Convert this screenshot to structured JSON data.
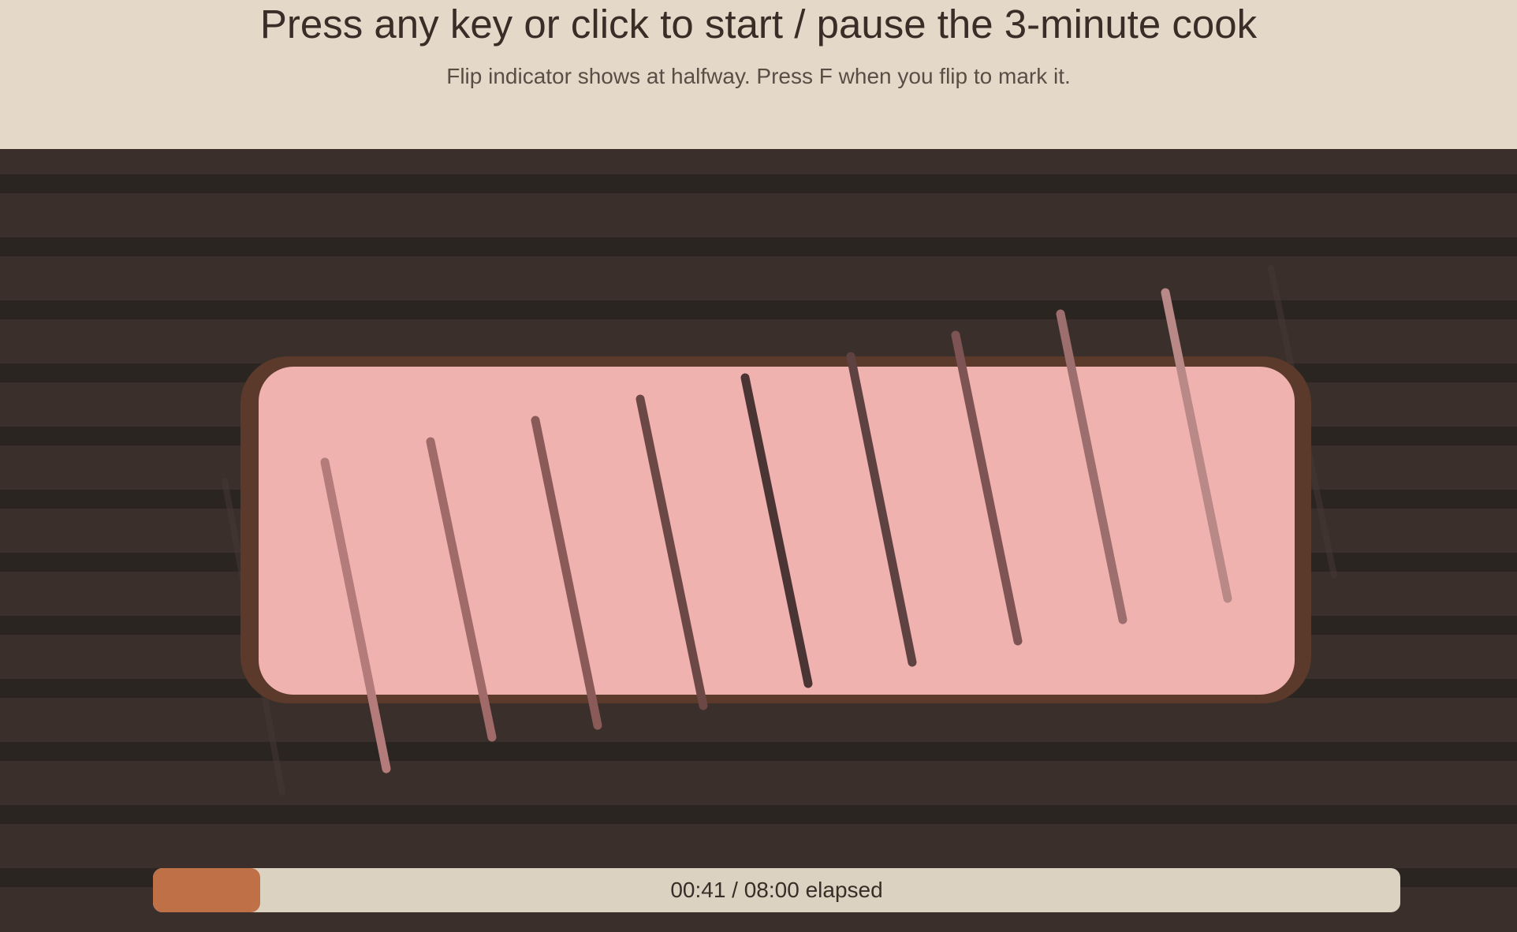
{
  "header": {
    "title": "Press any key or click to start / pause the 3-minute cook",
    "subtitle": "Flip indicator shows at halfway. Press F when you flip to mark it."
  },
  "timer": {
    "label": "00:41 / 08:00 elapsed",
    "progress": 0.085
  },
  "colors": {
    "header_bg": "#e4d9c8",
    "grill_bg": "#3a2f2b",
    "grate_bar": "#2a2521",
    "meat": "#f0b2ae",
    "meat_edge": "#5c3a2b",
    "sear_mark": "#4a3634",
    "progress_track": "#dbd2c1",
    "progress_fill": "#bf7046"
  }
}
